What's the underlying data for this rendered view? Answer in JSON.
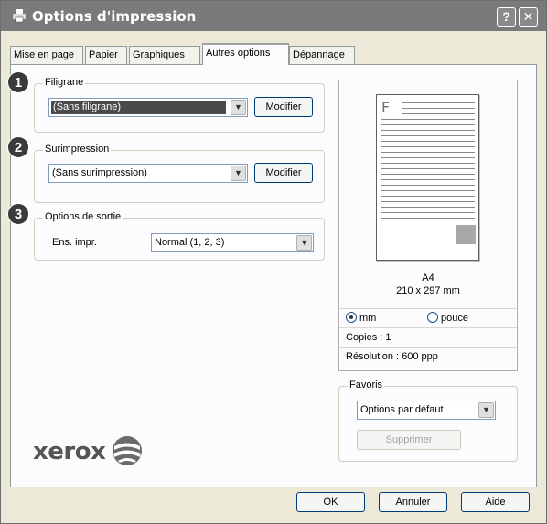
{
  "window": {
    "title": "Options d'impression",
    "help_label": "?",
    "close_label": "✕"
  },
  "tabs": [
    {
      "label": "Mise en page"
    },
    {
      "label": "Papier"
    },
    {
      "label": "Graphiques"
    },
    {
      "label": "Autres options",
      "active": true
    },
    {
      "label": "Dépannage"
    }
  ],
  "watermark": {
    "badge": "1",
    "legend": "Filigrane",
    "selected": "(Sans filigrane)",
    "edit_label": "Modifier"
  },
  "overlay": {
    "badge": "2",
    "legend": "Surimpression",
    "selected": "(Sans surimpression)",
    "edit_label": "Modifier"
  },
  "output": {
    "badge": "3",
    "legend": "Options de sortie",
    "print_set_label": "Ens. impr.",
    "selected": "Normal (1, 2, 3)"
  },
  "preview": {
    "page_letter": "F",
    "paper_size": "A4",
    "paper_dims": "210 x 297 mm",
    "unit_mm_label": "mm",
    "unit_inch_label": "pouce",
    "unit_selected": "mm",
    "copies": "Copies : 1",
    "resolution": "Résolution : 600 ppp"
  },
  "favorites": {
    "legend": "Favoris",
    "selected": "Options par défaut",
    "delete_label": "Supprimer"
  },
  "brand": {
    "logo_text": "xerox"
  },
  "footer": {
    "ok_label": "OK",
    "cancel_label": "Annuler",
    "help_label": "Aide"
  },
  "icons": {
    "printer": "printer-icon",
    "dropdown": "chevron-down-icon",
    "globe": "xerox-globe-icon"
  },
  "colors": {
    "titlebar": "#7a7a7a",
    "badge": "#3a3a3a",
    "selection": "#4a4a4a"
  }
}
